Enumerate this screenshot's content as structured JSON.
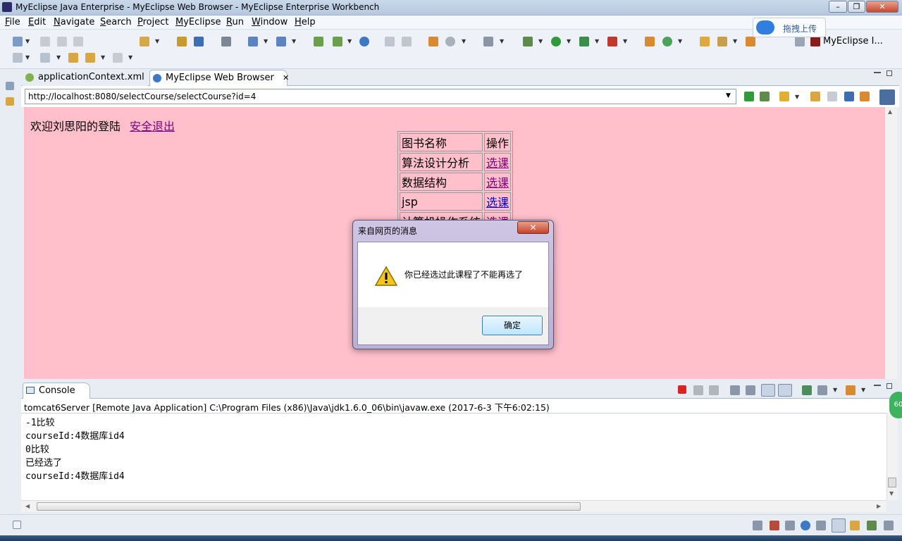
{
  "window": {
    "title": "MyEclipse Java Enterprise - MyEclipse Web Browser - MyEclipse Enterprise Workbench",
    "minimize": "–",
    "maximize": "❐",
    "close": "✕"
  },
  "menu": [
    "File",
    "Edit",
    "Navigate",
    "Search",
    "Project",
    "MyEclipse",
    "Run",
    "Window",
    "Help"
  ],
  "upload": {
    "label": "拖拽上传"
  },
  "perspective": {
    "label": "MyEclipse I..."
  },
  "editor_tabs": [
    {
      "label": "applicationContext.xml"
    },
    {
      "label": "MyEclipse Web Browser",
      "close": "✕"
    }
  ],
  "browser": {
    "url": "http://localhost:8080/selectCourse/selectCourse?id=4",
    "welcome": "欢迎刘思阳的登陆",
    "logout": "安全退出",
    "table": {
      "headers": [
        "图书名称",
        "操作"
      ],
      "rows": [
        {
          "name": "算法设计分析",
          "action": "选课"
        },
        {
          "name": "数据结构",
          "action": "选课"
        },
        {
          "name": "jsp",
          "action": "选课"
        },
        {
          "name": "计算机操作系统",
          "action": "选课"
        }
      ]
    }
  },
  "dialog": {
    "title": "来自网页的消息",
    "close": "✕",
    "message": "你已经选过此课程了不能再选了",
    "ok": "确定"
  },
  "console": {
    "tab_label": "Console",
    "tab_close": "✕",
    "header": "tomcat6Server [Remote Java Application] C:\\Program Files (x86)\\Java\\jdk1.6.0_06\\bin\\javaw.exe (2017-6-3 下午6:02:15)",
    "lines": [
      "-1比较",
      "courseId:4数据库id4",
      "0比较",
      "已经选了",
      "courseId:4数据库id4"
    ]
  },
  "badge": "60",
  "colors": {
    "page_bg": "#ffc0cb",
    "link_visited": "#800080",
    "link": "#0000ee",
    "accent": "#2f7ee0"
  }
}
